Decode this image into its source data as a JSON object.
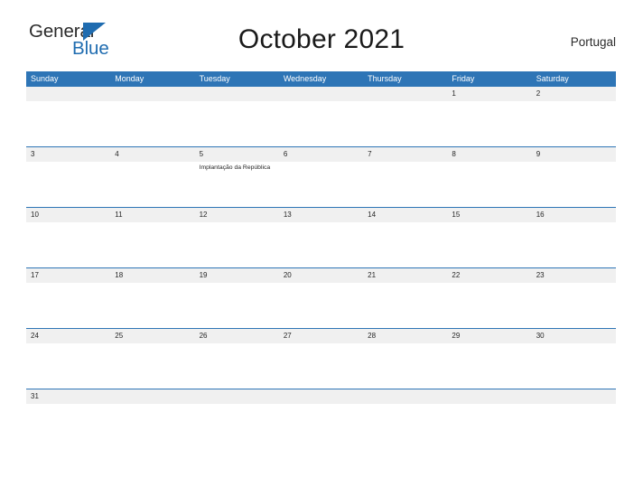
{
  "branding": {
    "logo_text_top": "General",
    "logo_text_bottom": "Blue",
    "logo_top_color": "#2b2b2b",
    "logo_bottom_color": "#1f6cb0",
    "logo_triangle_color": "#1f6cb0"
  },
  "header": {
    "title": "October 2021",
    "country": "Portugal"
  },
  "theme": {
    "header_bar_color": "#2e75b6",
    "week_separator_color": "#2e75b6",
    "date_band_color": "#f0f0f0",
    "page_background": "#ffffff",
    "text_color": "#262626"
  },
  "calendar": {
    "month": "October",
    "year": "2021",
    "day_headers": [
      "Sunday",
      "Monday",
      "Tuesday",
      "Wednesday",
      "Thursday",
      "Friday",
      "Saturday"
    ],
    "weeks": [
      {
        "days": [
          {
            "num": "",
            "event": ""
          },
          {
            "num": "",
            "event": ""
          },
          {
            "num": "",
            "event": ""
          },
          {
            "num": "",
            "event": ""
          },
          {
            "num": "",
            "event": ""
          },
          {
            "num": "1",
            "event": ""
          },
          {
            "num": "2",
            "event": ""
          }
        ]
      },
      {
        "days": [
          {
            "num": "3",
            "event": ""
          },
          {
            "num": "4",
            "event": ""
          },
          {
            "num": "5",
            "event": "Implantação da República"
          },
          {
            "num": "6",
            "event": ""
          },
          {
            "num": "7",
            "event": ""
          },
          {
            "num": "8",
            "event": ""
          },
          {
            "num": "9",
            "event": ""
          }
        ]
      },
      {
        "days": [
          {
            "num": "10",
            "event": ""
          },
          {
            "num": "11",
            "event": ""
          },
          {
            "num": "12",
            "event": ""
          },
          {
            "num": "13",
            "event": ""
          },
          {
            "num": "14",
            "event": ""
          },
          {
            "num": "15",
            "event": ""
          },
          {
            "num": "16",
            "event": ""
          }
        ]
      },
      {
        "days": [
          {
            "num": "17",
            "event": ""
          },
          {
            "num": "18",
            "event": ""
          },
          {
            "num": "19",
            "event": ""
          },
          {
            "num": "20",
            "event": ""
          },
          {
            "num": "21",
            "event": ""
          },
          {
            "num": "22",
            "event": ""
          },
          {
            "num": "23",
            "event": ""
          }
        ]
      },
      {
        "days": [
          {
            "num": "24",
            "event": ""
          },
          {
            "num": "25",
            "event": ""
          },
          {
            "num": "26",
            "event": ""
          },
          {
            "num": "27",
            "event": ""
          },
          {
            "num": "28",
            "event": ""
          },
          {
            "num": "29",
            "event": ""
          },
          {
            "num": "30",
            "event": ""
          }
        ]
      },
      {
        "days": [
          {
            "num": "31",
            "event": ""
          },
          {
            "num": "",
            "event": ""
          },
          {
            "num": "",
            "event": ""
          },
          {
            "num": "",
            "event": ""
          },
          {
            "num": "",
            "event": ""
          },
          {
            "num": "",
            "event": ""
          },
          {
            "num": "",
            "event": ""
          }
        ]
      }
    ]
  }
}
